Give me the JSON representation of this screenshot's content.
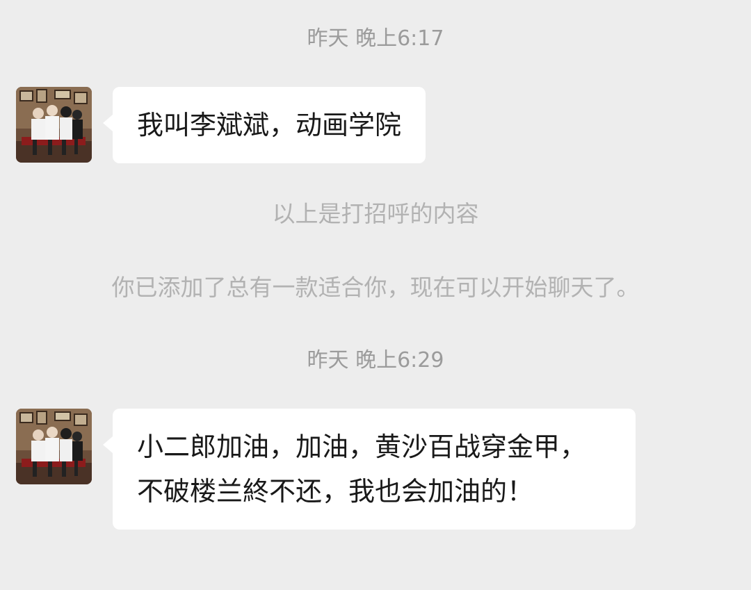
{
  "messages": [
    {
      "type": "timestamp",
      "text": "昨天 晚上6:17"
    },
    {
      "type": "received",
      "avatar": "group-photo-avatar",
      "text": "我叫李斌斌，动画学院"
    },
    {
      "type": "system",
      "text": "以上是打招呼的内容"
    },
    {
      "type": "system",
      "text": "你已添加了总有一款适合你，现在可以开始聊天了。"
    },
    {
      "type": "timestamp",
      "text": "昨天 晚上6:29"
    },
    {
      "type": "received",
      "avatar": "group-photo-avatar",
      "text": "小二郎加油，加油，黄沙百战穿金甲，不破楼兰終不还，我也会加油的！"
    }
  ],
  "colors": {
    "background": "#ededed",
    "bubble": "#ffffff",
    "timestamp_text": "#9b9b9b",
    "system_text": "#b2b2b2",
    "message_text": "#191919"
  }
}
